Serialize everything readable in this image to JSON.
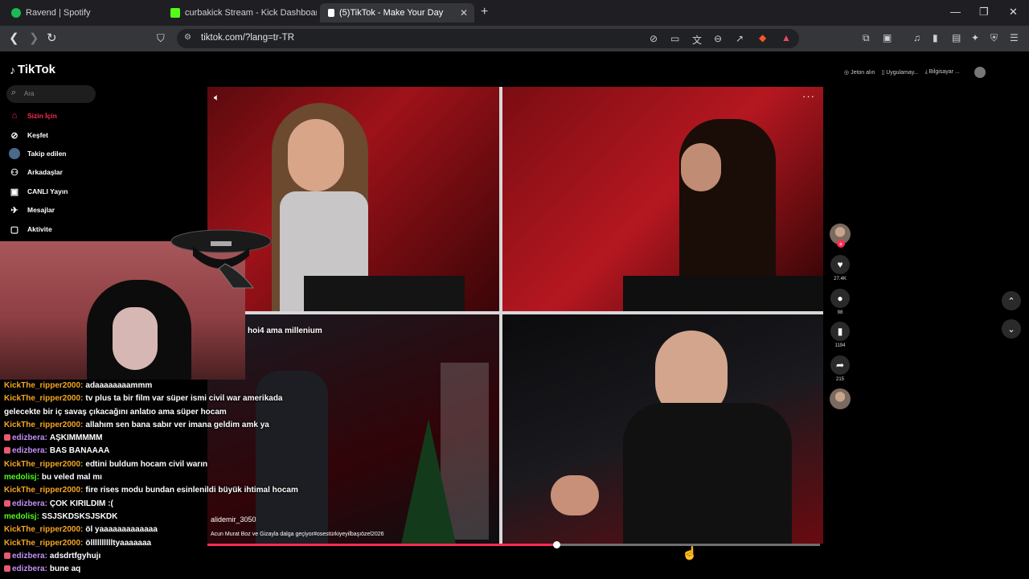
{
  "tabs": [
    {
      "title": "Ravend | Spotify",
      "color": "#1db954"
    },
    {
      "title": "curbakick Stream - Kick Dashboard",
      "color": "#53fc18"
    },
    {
      "title": "(5)TikTok - Make Your Day",
      "color": "#ffffff"
    }
  ],
  "url": "tiktok.com/?lang=tr-TR",
  "tiktok": {
    "logo": "TikTok",
    "search_placeholder": "Ara",
    "nav": [
      {
        "label": "Sizin İçin",
        "icon": "home-icon",
        "active": true
      },
      {
        "label": "Keşfet",
        "icon": "compass-icon"
      },
      {
        "label": "Takip edilen",
        "icon": "following-icon"
      },
      {
        "label": "Arkadaşlar",
        "icon": "friends-icon"
      },
      {
        "label": "CANLI Yayın",
        "icon": "live-icon"
      },
      {
        "label": "Mesajlar",
        "icon": "messages-icon"
      },
      {
        "label": "Aktivite",
        "icon": "activity-icon"
      }
    ],
    "top_right": {
      "coins": "Jeton alın",
      "app": "Uygulamay...",
      "computer": "Bilgisayar ..."
    },
    "video": {
      "author": "alidemir_3050",
      "caption": "Acun Murat Boz ve Gizayla dalga geçiyor#osestürkiyeyilbaşıözel2026",
      "progress": 0.57
    },
    "actions": {
      "likes": "27.4K",
      "comments": "98",
      "saves": "1194",
      "shares": "215"
    }
  },
  "stream_overlay": {
    "text": "hoi4 ama millenium"
  },
  "chat": [
    {
      "user": "KickThe_ripper2000",
      "color": "#f5a623",
      "text": "adaaaaaaaammm"
    },
    {
      "user": "KickThe_ripper2000",
      "color": "#f5a623",
      "text": "tv plus ta bir film var süper ismi civil war amerikada"
    },
    {
      "user": "",
      "color": "#ffffff",
      "text": "gelecekte bir iç savaş çıkacağını anlatıo ama süper hocam"
    },
    {
      "user": "KickThe_ripper2000",
      "color": "#f5a623",
      "text": "allahım sen bana sabır ver imana geldim amk ya"
    },
    {
      "user": "edizbera",
      "color": "#c490f5",
      "text": "AŞKIMMMMM",
      "badge": true
    },
    {
      "user": "edizbera",
      "color": "#c490f5",
      "text": "BAS BANAAAA",
      "badge": true
    },
    {
      "user": "KickThe_ripper2000",
      "color": "#f5a623",
      "text": "edtini buldum hocam civil warın"
    },
    {
      "user": "medolisj",
      "color": "#53fc18",
      "text": "bu veled mal mı"
    },
    {
      "user": "KickThe_ripper2000",
      "color": "#f5a623",
      "text": "fire rises modu bundan esinlenildi büyük ihtimal hocam"
    },
    {
      "user": "edizbera",
      "color": "#c490f5",
      "text": "ÇOK KIRILDIM :(",
      "badge": true
    },
    {
      "user": "medolisj",
      "color": "#53fc18",
      "text": "SSJSKDSKSJSKDK"
    },
    {
      "user": "KickThe_ripper2000",
      "color": "#f5a623",
      "text": "öl yaaaaaaaaaaaaa"
    },
    {
      "user": "KickThe_ripper2000",
      "color": "#f5a623",
      "text": "ölllllllllltyaaaaaaa"
    },
    {
      "user": "edizbera",
      "color": "#c490f5",
      "text": "adsdrtfgyhujı",
      "badge": true
    },
    {
      "user": "edizbera",
      "color": "#c490f5",
      "text": "bune aq",
      "badge": true
    }
  ],
  "colors": {
    "accent": "#fe2c55"
  }
}
